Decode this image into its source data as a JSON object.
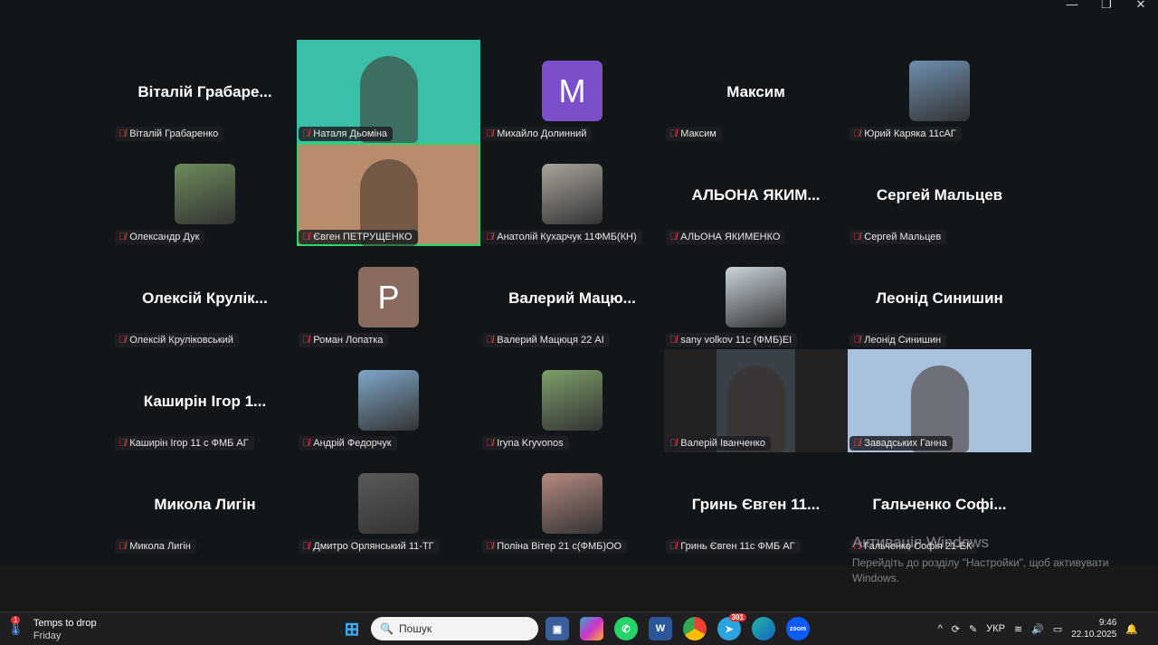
{
  "window": {
    "minimize": "—",
    "restore": "❐",
    "close": "✕"
  },
  "tiles": [
    {
      "type": "name",
      "big": "Віталій Грабаре...",
      "label": "Віталій Грабаренко"
    },
    {
      "type": "video",
      "bg": "#3cbfa8",
      "label": "Наталя Дьоміна"
    },
    {
      "type": "letter",
      "letter": "M",
      "color": "#7b4fc9",
      "label": "Михайло Долинний"
    },
    {
      "type": "name",
      "big": "Максим",
      "label": "Максим"
    },
    {
      "type": "photo",
      "bg": "#6e8fb0",
      "label": "Юрий Каряка 11сАГ"
    },
    {
      "type": "photo",
      "bg": "#6c8c5c",
      "label": "Олександр Дук"
    },
    {
      "type": "video",
      "bg": "#b98c6c",
      "label": "Євген ПЕТРУЩЕНКО",
      "active": true
    },
    {
      "type": "photo",
      "bg": "#a9a39b",
      "label": "Анатолій Кухарчук 11ФМБ(КН)"
    },
    {
      "type": "name",
      "big": "АЛЬОНА  ЯКИМ...",
      "label": "АЛЬОНА ЯКИМЕНКО"
    },
    {
      "type": "name",
      "big": "Сергей Мальцев",
      "label": "Сергей Мальцев"
    },
    {
      "type": "name",
      "big": "Олексій Крулік...",
      "label": "Олексій Круліковський"
    },
    {
      "type": "letter",
      "letter": "P",
      "color": "#8a6b5f",
      "label": "Роман Лопатка"
    },
    {
      "type": "name",
      "big": "Валерий  Мацю...",
      "label": "Валерий Мацюця 22 АІ"
    },
    {
      "type": "photo",
      "bg": "#c9d4dc",
      "label": "sany volkov 11с (ФМБ)ЕІ"
    },
    {
      "type": "name",
      "big": "Леонід Синишин",
      "label": "Леонід Синишин"
    },
    {
      "type": "name",
      "big": "Каширін Ігор 1...",
      "label": "Каширін Ігор 11 с ФМБ АГ"
    },
    {
      "type": "photo",
      "bg": "#7fa6c9",
      "label": "Андрій Федорчук"
    },
    {
      "type": "photo",
      "bg": "#7c9f6a",
      "label": "Iryna Kryvonos"
    },
    {
      "type": "video",
      "bg": "#2a2d31",
      "label": "Валерій Іванченко"
    },
    {
      "type": "video",
      "bg": "#a9c1dc",
      "label": "Завадських Ганна"
    },
    {
      "type": "name",
      "big": "Микола Лигін",
      "label": "Микола Лигін"
    },
    {
      "type": "photo",
      "bg": "#5b5a58",
      "label": "Дмитро Орлянський 11-ТГ"
    },
    {
      "type": "photo",
      "bg": "#b58a80",
      "label": "Поліна Вітер 21 с(ФМБ)ОО"
    },
    {
      "type": "name",
      "big": "Гринь Євген  11...",
      "label": "Гринь Євген 11с ФМБ АГ"
    },
    {
      "type": "name",
      "big": "Гальченко  Софі...",
      "label": "Гальченко Софія 21-ЕК"
    }
  ],
  "watermark": {
    "title": "Активація Windows",
    "text": "Перейдіть до розділу \"Настройки\", щоб активувати Windows."
  },
  "taskbar": {
    "weather_title": "Temps to drop",
    "weather_sub": "Friday",
    "weather_badge": "1",
    "search_placeholder": "Пошук",
    "telegram_badge": "301",
    "language": "УКР",
    "time": "9:46",
    "date": "22.10.2025"
  }
}
